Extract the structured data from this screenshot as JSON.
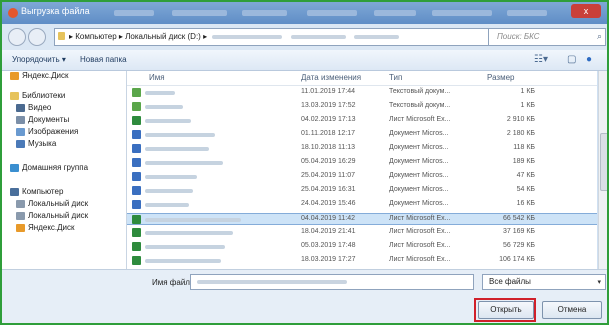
{
  "window": {
    "title": "Выгрузка файла",
    "close_glyph": "x"
  },
  "address": {
    "breadcrumb": [
      "Компьютер",
      "Локальный диск (D:)"
    ],
    "separator": "▸",
    "refresh_glyph": "↻",
    "search_placeholder": "Поиск: БКС"
  },
  "toolbar": {
    "organize": "Упорядочить ▾",
    "new_folder": "Новая папка"
  },
  "sidebar": {
    "items": [
      {
        "label": "Яндекс.Диск",
        "icon": "yandex-disk-icon",
        "color": "#e89a2a"
      },
      {
        "label": "Библиотеки",
        "icon": "libraries-icon",
        "color": "#e6c35c"
      },
      {
        "label": "Видео",
        "icon": "video-icon",
        "color": "#4b6a90"
      },
      {
        "label": "Документы",
        "icon": "documents-icon",
        "color": "#7b8fa8"
      },
      {
        "label": "Изображения",
        "icon": "images-icon",
        "color": "#6a9ad0"
      },
      {
        "label": "Музыка",
        "icon": "music-icon",
        "color": "#4b7ab8"
      },
      {
        "label": "Домашняя группа",
        "icon": "homegroup-icon",
        "color": "#3b8fd0"
      },
      {
        "label": "Компьютер",
        "icon": "computer-icon",
        "color": "#4a6f9b"
      },
      {
        "label": "Локальный диск",
        "icon": "disk-icon",
        "color": "#8a9aad"
      },
      {
        "label": "Локальный диск",
        "icon": "disk-icon",
        "color": "#8a9aad"
      },
      {
        "label": "Яндекс.Диск",
        "icon": "yandex-disk-icon",
        "color": "#e89a2a"
      }
    ]
  },
  "list": {
    "columns": {
      "name": "Имя",
      "date": "Дата изменения",
      "type": "Тип",
      "size": "Размер"
    },
    "rows": [
      {
        "date": "11.01.2019 17:44",
        "type": "Текстовый докум...",
        "size": "1 КБ",
        "kind": "txt"
      },
      {
        "date": "13.03.2019 17:52",
        "type": "Текстовый докум...",
        "size": "1 КБ",
        "kind": "txt"
      },
      {
        "date": "04.02.2019 17:13",
        "type": "Лист Microsoft Ex...",
        "size": "2 910 КБ",
        "kind": "xls"
      },
      {
        "date": "01.11.2018 12:17",
        "type": "Документ Micros...",
        "size": "2 180 КБ",
        "kind": "doc"
      },
      {
        "date": "18.10.2018 11:13",
        "type": "Документ Micros...",
        "size": "118 КБ",
        "kind": "doc"
      },
      {
        "date": "05.04.2019 16:29",
        "type": "Документ Micros...",
        "size": "189 КБ",
        "kind": "doc"
      },
      {
        "date": "25.04.2019 11:07",
        "type": "Документ Micros...",
        "size": "47 КБ",
        "kind": "doc"
      },
      {
        "date": "25.04.2019 16:31",
        "type": "Документ Micros...",
        "size": "54 КБ",
        "kind": "doc"
      },
      {
        "date": "24.04.2019 15:46",
        "type": "Документ Micros...",
        "size": "16 КБ",
        "kind": "doc"
      },
      {
        "date": "04.04.2019 11:42",
        "type": "Лист Microsoft Ex...",
        "size": "66 542 КБ",
        "kind": "xls",
        "selected": true
      },
      {
        "date": "18.04.2019 21:41",
        "type": "Лист Microsoft Ex...",
        "size": "37 169 КБ",
        "kind": "xls"
      },
      {
        "date": "05.03.2019 17:48",
        "type": "Лист Microsoft Ex...",
        "size": "56 729 КБ",
        "kind": "xls"
      },
      {
        "date": "18.03.2019 17:27",
        "type": "Лист Microsoft Ex...",
        "size": "106 174 КБ",
        "kind": "xls"
      }
    ]
  },
  "bottom": {
    "filename_label": "Имя файла:",
    "filter_value": "Все файлы",
    "open_label": "Открыть",
    "cancel_label": "Отмена"
  },
  "colors": {
    "txt": "#5aa64a",
    "xls": "#2e8b3d",
    "doc": "#3a6fc0",
    "highlight": "#d0202a"
  }
}
